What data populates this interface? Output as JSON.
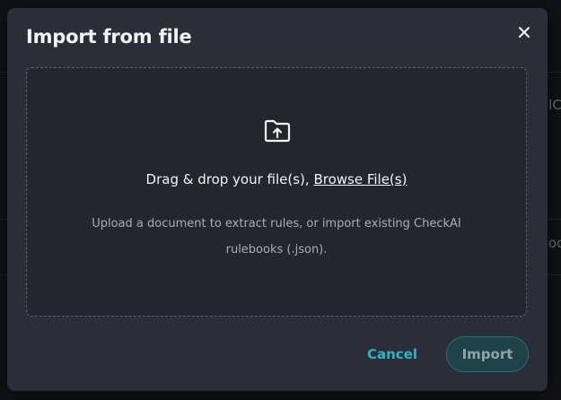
{
  "dialog": {
    "title": "Import from file",
    "close_icon": "close-icon"
  },
  "dropzone": {
    "icon": "folder-upload-icon",
    "drag_text": "Drag & drop your file(s), ",
    "browse_label": "Browse File(s)",
    "help_text": "Upload a document to extract rules, or import existing CheckAI rulebooks (.json)."
  },
  "actions": {
    "cancel_label": "Cancel",
    "import_label": "Import"
  },
  "background": {
    "right_fragment_top": "IC",
    "right_fragment_mid": "oc"
  },
  "colors": {
    "accent": "#2eb3c9",
    "modal_bg": "#2b2e36",
    "dropzone_bg": "#24262d"
  }
}
